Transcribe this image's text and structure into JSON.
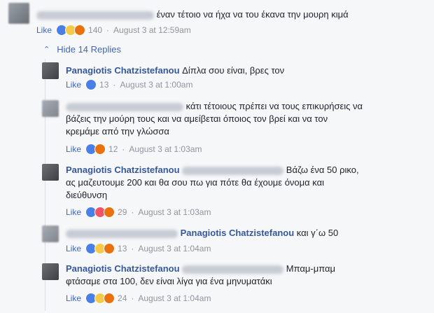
{
  "top_comment": {
    "text": "έναν τέτοιο να ήχα να του έκανα την μουρη κιμά",
    "like_label": "Like",
    "reactions": [
      "like",
      "haha",
      "angry"
    ],
    "count": "140",
    "time": "August 3 at 12:59am"
  },
  "hide_replies_label": "Hide 14 Replies",
  "replies": [
    {
      "name": "Panagiotis Chatzistefanou",
      "text": "Δίπλα σου είναι, βρες τον",
      "like_label": "Like",
      "count": "13",
      "time": "August 3 at 1:00am"
    },
    {
      "name": "",
      "text_line1": "κάτι τέτοιους πρέπει να τους επικυρήσεις να",
      "text_line2": "βάζεις την μούρη τους και να αμείβεται όποιος τον βρεί και να τον",
      "text_line3": "κρεμάμε από την γλώσσα",
      "like_label": "Like",
      "count": "12",
      "time": "August 3 at 1:03am"
    },
    {
      "name": "Panagiotis Chatzistefanou",
      "text_line1": "Βάζω ένα 50 ρικο,",
      "text_line2": "ας μαζευτουμε 200 και θα σου πω για πότε θα έχουμε όνομα και",
      "text_line3": "διεύθυνση",
      "like_label": "Like",
      "count": "29",
      "time": "August 3 at 1:03am"
    },
    {
      "mention": "Panagiotis Chatzistefanou",
      "text": "και γ΄ω 50",
      "like_label": "Like",
      "count": "13",
      "time": "August 3 at 1:04am"
    },
    {
      "name": "Panagiotis Chatzistefanou",
      "text_line1": "Μπαμ-μπαμ",
      "text_line2": "φτάσαμε στα 100, δεν είναι λίγα για ένα μηνυματάκι",
      "like_label": "Like",
      "count": "24",
      "time": "August 3 at 1:04am"
    }
  ]
}
